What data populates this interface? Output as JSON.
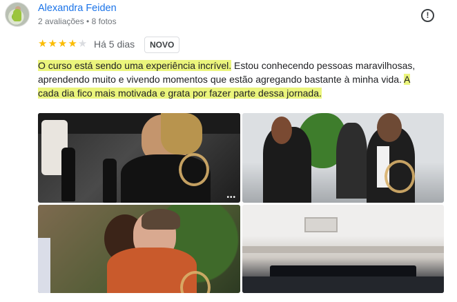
{
  "reviewer": {
    "name": "Alexandra Feiden",
    "meta": "2 avaliações • 8 fotos",
    "avatar_icon": "profile-photo"
  },
  "rating": {
    "stars": 4,
    "max": 5,
    "date": "Há 5 dias",
    "badge": "NOVO"
  },
  "review": {
    "segments": [
      {
        "text": "O curso está sendo uma experiência incrível.",
        "highlight": true
      },
      {
        "text": " Estou conhecendo pessoas maravilhosas, aprendendo muito e vivendo momentos que estão agregando bastante à minha vida. ",
        "highlight": false
      },
      {
        "text": "A cada dia fico mais motivada e grata por fazer parte dessa jornada.",
        "highlight": true
      }
    ]
  },
  "colors": {
    "link": "#1a73e8",
    "star": "#fbbc04",
    "highlight": "#ebf57c"
  },
  "icons": {
    "report": "report-icon",
    "star": "star-icon"
  },
  "photos": [
    {
      "description_icon": "photo-1"
    },
    {
      "description_icon": "photo-2"
    },
    {
      "description_icon": "photo-3"
    },
    {
      "description_icon": "photo-4"
    }
  ]
}
